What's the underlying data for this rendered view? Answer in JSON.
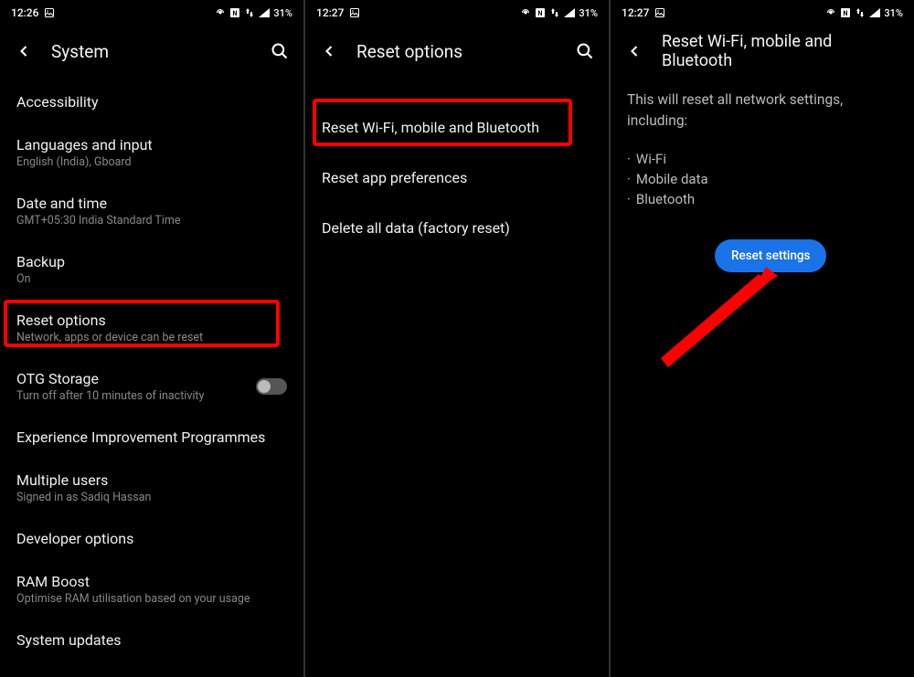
{
  "panel1": {
    "status": {
      "time": "12:26",
      "battery": "31%"
    },
    "header_title": "System",
    "items": [
      {
        "title": "Accessibility",
        "sub": ""
      },
      {
        "title": "Languages and input",
        "sub": "English (India), Gboard"
      },
      {
        "title": "Date and time",
        "sub": "GMT+05:30 India Standard Time"
      },
      {
        "title": "Backup",
        "sub": "On"
      },
      {
        "title": "Reset options",
        "sub": "Network, apps or device can be reset"
      },
      {
        "title": "OTG Storage",
        "sub": "Turn off after 10 minutes of inactivity",
        "toggle": true
      },
      {
        "title": "Experience Improvement Programmes",
        "sub": ""
      },
      {
        "title": "Multiple users",
        "sub": "Signed in as Sadiq Hassan"
      },
      {
        "title": "Developer options",
        "sub": ""
      },
      {
        "title": "RAM Boost",
        "sub": "Optimise RAM utilisation based on your usage"
      },
      {
        "title": "System updates",
        "sub": ""
      }
    ]
  },
  "panel2": {
    "status": {
      "time": "12:27",
      "battery": "31%"
    },
    "header_title": "Reset options",
    "items": [
      {
        "title": "Reset Wi-Fi, mobile and Bluetooth"
      },
      {
        "title": "Reset app preferences"
      },
      {
        "title": "Delete all data (factory reset)"
      }
    ]
  },
  "panel3": {
    "status": {
      "time": "12:27",
      "battery": "31%"
    },
    "header_title": "Reset Wi-Fi, mobile and Bluetooth",
    "info": "This will reset all network settings, including:",
    "bullets": [
      "Wi-Fi",
      "Mobile data",
      "Bluetooth"
    ],
    "reset_button": "Reset settings"
  }
}
